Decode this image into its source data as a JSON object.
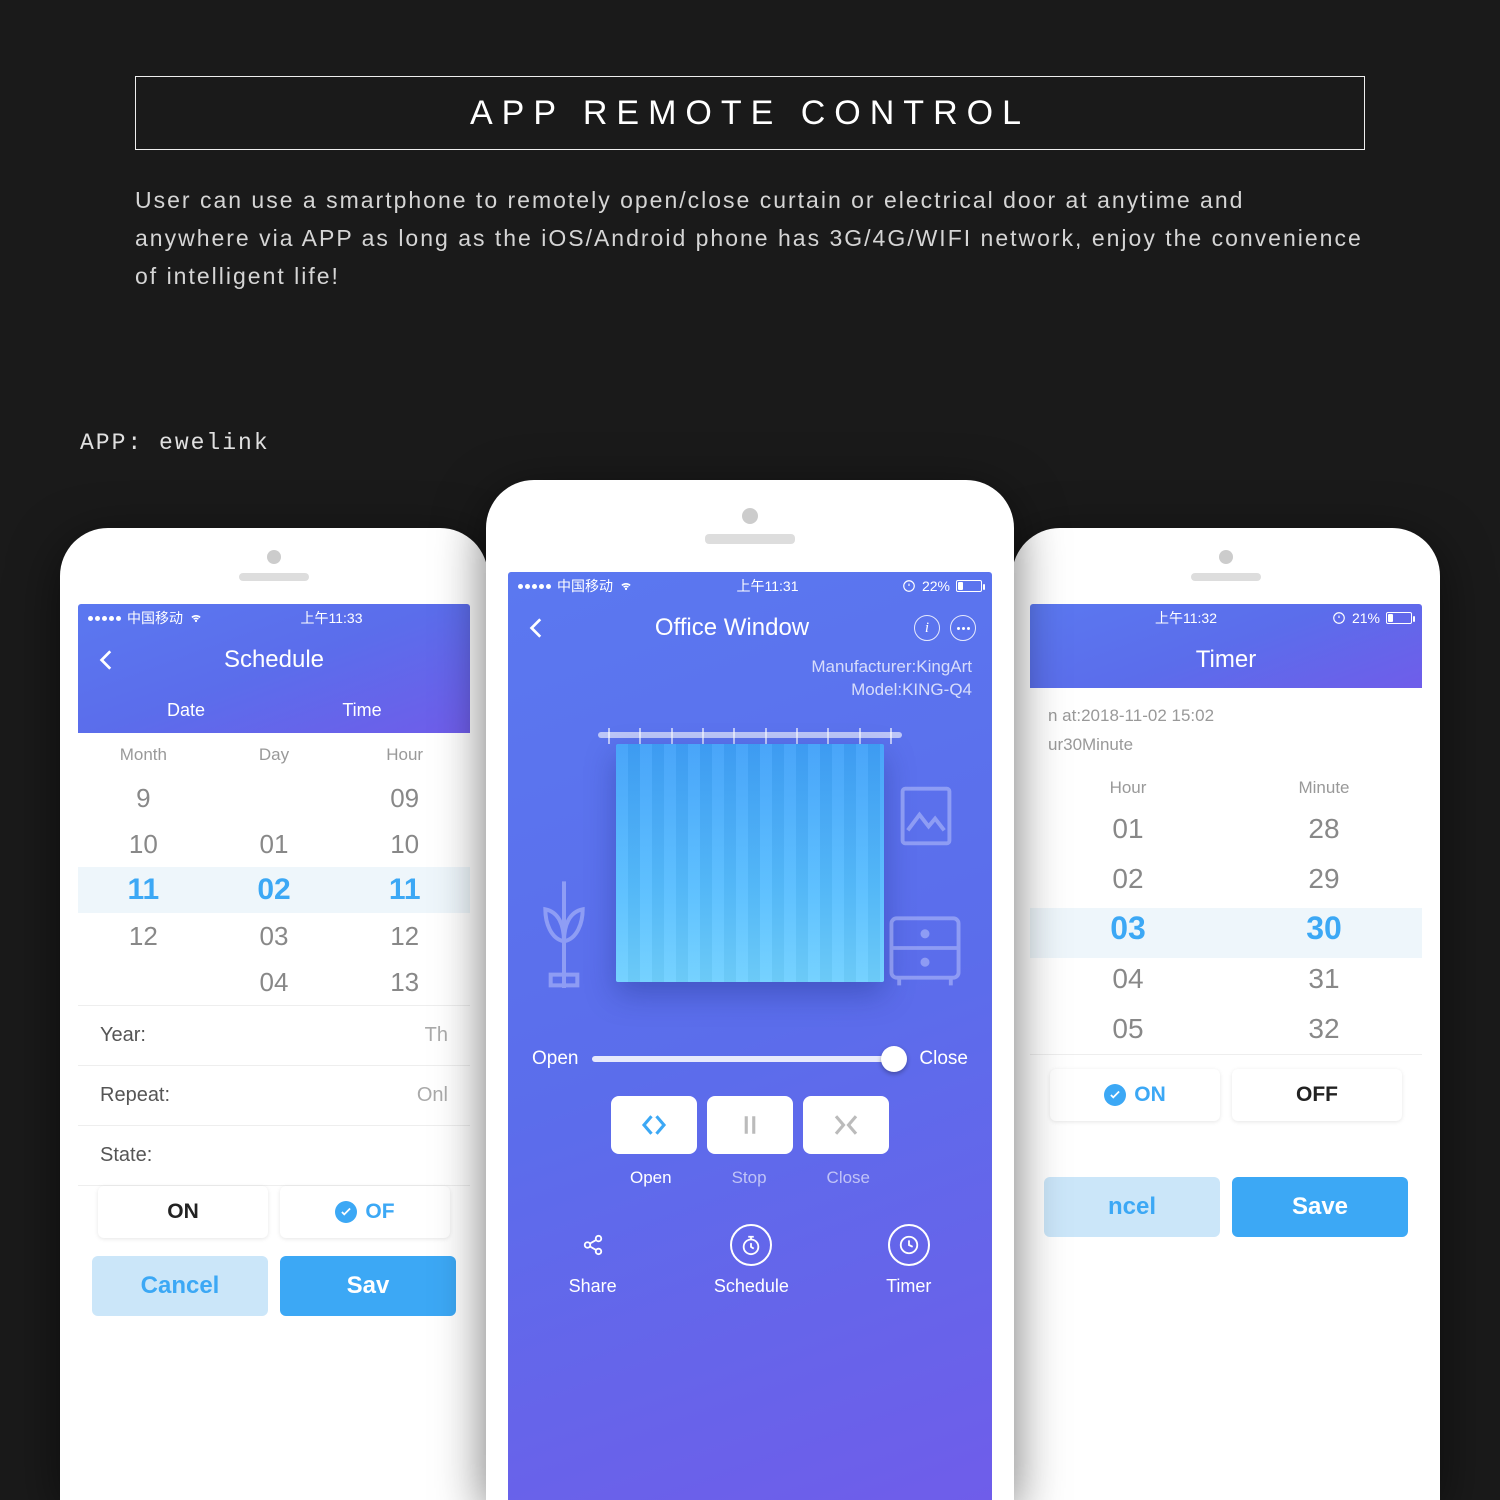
{
  "banner": {
    "title": "APP REMOTE CONTROL"
  },
  "description": "User can use a smartphone to remotely open/close curtain or electrical door at anytime and anywhere via APP as long as the iOS/Android phone has 3G/4G/WIFI network, enjoy the convenience of intelligent life!",
  "app_label": "APP: ewelink",
  "status": {
    "carrier": "中国移动",
    "left_time": "上午11:33",
    "center_time": "上午11:31",
    "right_time": "上午11:32",
    "center_batt": "22%",
    "right_batt": "21%"
  },
  "schedule": {
    "title": "Schedule",
    "header_date": "Date",
    "header_time": "Time",
    "cols": {
      "month": {
        "label": "Month",
        "items": [
          "9",
          "10",
          "11",
          "12",
          ""
        ]
      },
      "day": {
        "label": "Day",
        "items": [
          "",
          "01",
          "02",
          "03",
          "04"
        ]
      },
      "hour": {
        "label": "Hour",
        "items": [
          "09",
          "10",
          "11",
          "12",
          "13"
        ]
      }
    },
    "sel_index": 2,
    "year_label": "Year:",
    "year_value": "Th",
    "repeat_label": "Repeat:",
    "repeat_value": "Onl",
    "state_label": "State:",
    "on_label": "ON",
    "off_label": "OF",
    "cancel": "Cancel",
    "save": "Sav"
  },
  "device": {
    "title": "Office Window",
    "manufacturer_label": "Manufacturer:",
    "manufacturer": "KingArt",
    "model_label": "Model:",
    "model": "KING-Q4",
    "slider_open": "Open",
    "slider_close": "Close",
    "btn_open": "Open",
    "btn_stop": "Stop",
    "btn_close": "Close",
    "nav_share": "Share",
    "nav_schedule": "Schedule",
    "nav_timer": "Timer"
  },
  "timer": {
    "title": "Timer",
    "run_at": "n at:2018-11-02 15:02",
    "duration": "ur30Minute",
    "hour_label": "Hour",
    "minute_label": "Minute",
    "hours": [
      "01",
      "02",
      "03",
      "04",
      "05"
    ],
    "minutes": [
      "28",
      "29",
      "30",
      "31",
      "32"
    ],
    "sel_index": 2,
    "on_label": "ON",
    "off_label": "OFF",
    "cancel": "ncel",
    "save": "Save"
  }
}
